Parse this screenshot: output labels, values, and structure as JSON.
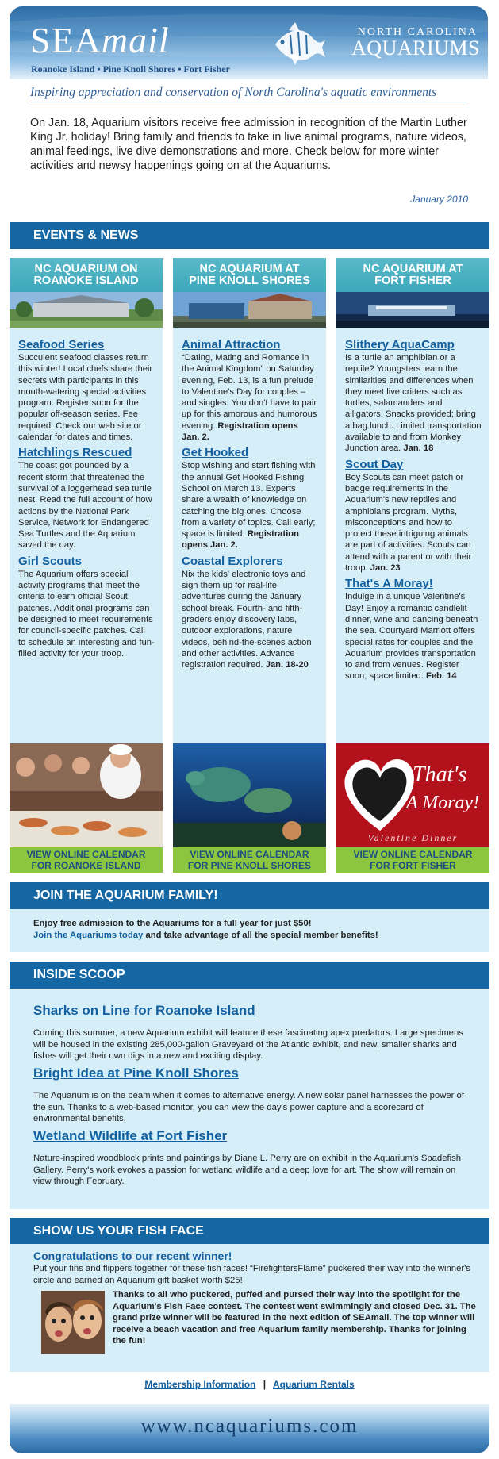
{
  "header": {
    "logo_sea": "SEA",
    "logo_mail": "mail",
    "locations": "Roanoke Island • Pine Knoll Shores • Fort Fisher",
    "org_top": "NORTH CAROLINA",
    "org_main": "AQUARIUMS"
  },
  "tagline": "Inspiring appreciation and conservation of North Carolina's aquatic environments",
  "intro": "On Jan. 18, Aquarium visitors receive free admission in recognition of the Martin Luther King Jr. holiday!  Bring family and friends to take in live animal programs, nature videos, animal feedings, live dive demonstrations and more. Check below for more winter activities and newsy happenings going on at the Aquariums.",
  "date": "January 2010",
  "events": {
    "heading": "EVENTS & NEWS",
    "columns": [
      {
        "title_line1": "NC AQUARIUM ON",
        "title_line2": "ROANOKE ISLAND",
        "items": [
          {
            "title": "Seafood Series",
            "text": "Succulent seafood classes return this winter! Local chefs share their secrets with participants in this mouth-watering special activities program. Register soon for the popular off-season series. Fee required. Check our web site or calendar for dates and times.",
            "bold": ""
          },
          {
            "title": "Hatchlings Rescued",
            "text": "The coast got pounded by a recent storm that threatened the survival of a loggerhead sea turtle nest. Read the full account of how actions by the National Park Service, Network for Endangered Sea Turtles and the Aquarium saved the day.",
            "bold": ""
          },
          {
            "title": "Girl Scouts",
            "text": "The Aquarium offers special activity programs that meet the criteria to earn official Scout patches. Additional programs can be designed to meet requirements for council-specific patches. Call to schedule an interesting and fun-filled activity for your troop.",
            "bold": ""
          }
        ],
        "link_line1": "VIEW ONLINE CALENDAR",
        "link_line2": "FOR ROANOKE ISLAND"
      },
      {
        "title_line1": "NC AQUARIUM AT",
        "title_line2": "PINE KNOLL SHORES",
        "items": [
          {
            "title": "Animal Attraction",
            "text": "“Dating, Mating and Romance in the Animal Kingdom” on Saturday evening, Feb. 13, is a fun prelude to Valentine's Day for couples – and singles. You don't have to pair up for this amorous and humorous evening. ",
            "bold": "Registration opens Jan. 2."
          },
          {
            "title": "Get Hooked",
            "text": "Stop wishing and start fishing with the annual Get Hooked Fishing School on March 13. Experts share a wealth of knowledge on catching the big ones. Choose from a variety of topics. Call early; space is limited. ",
            "bold": "Registration opens Jan. 2."
          },
          {
            "title": "Coastal Explorers",
            "text": "Nix the kids' electronic toys and sign them up for real-life adventures during the January school break. Fourth- and fifth- graders enjoy discovery labs, outdoor explorations, nature videos, behind-the-scenes action and other activities. Advance registration required. ",
            "bold": "Jan. 18-20"
          }
        ],
        "link_line1": "VIEW ONLINE CALENDAR",
        "link_line2": "FOR PINE KNOLL SHORES"
      },
      {
        "title_line1": "NC AQUARIUM AT",
        "title_line2": "FORT FISHER",
        "items": [
          {
            "title": "Slithery AquaCamp",
            "text": "Is a turtle an amphibian or a reptile? Youngsters learn the similarities and differences when they meet live critters such as turtles, salamanders and alligators. Snacks provided; bring a bag lunch. Limited transportation available to and from Monkey Junction area. ",
            "bold": "Jan. 18"
          },
          {
            "title": "Scout Day",
            "text": "Boy Scouts can meet patch or badge requirements in the Aquarium's new reptiles and amphibians program. Myths, misconceptions and how to protect these intriguing animals are part of activities. Scouts can attend with a parent or with their troop. ",
            "bold": "Jan. 23"
          },
          {
            "title": "That's A Moray!",
            "text": "Indulge in a unique Valentine's Day! Enjoy a romantic candlelit dinner, wine and dancing beneath the sea. Courtyard Marriott offers special rates for couples and the Aquarium provides transportation to and from venues. Register soon; space limited. ",
            "bold": "Feb. 14"
          }
        ],
        "link_line1": "VIEW ONLINE CALENDAR",
        "link_line2": "FOR FORT FISHER"
      }
    ],
    "moray_image_line1": "That's",
    "moray_image_line2": "A Moray!",
    "moray_image_sub": "Valentine Dinner"
  },
  "join": {
    "heading": "JOIN THE AQUARIUM FAMILY!",
    "line1": "Enjoy free admission to the Aquariums for a full year for just $50!",
    "link": "Join the Aquariums today",
    "line2_rest": " and take advantage of all the special member benefits!"
  },
  "scoop": {
    "heading": "INSIDE SCOOP",
    "items": [
      {
        "title": "Sharks on Line for Roanoke Island",
        "text": "Coming this summer, a new Aquarium exhibit will feature these fascinating apex predators. Large specimens will be housed in the existing 285,000-gallon Graveyard of the Atlantic exhibit, and new, smaller sharks and fishes will get their own digs in a new and exciting display."
      },
      {
        "title": "Bright Idea at Pine Knoll Shores",
        "text": "The Aquarium is on the beam when it comes to alternative energy. A new solar panel harnesses the power of the sun. Thanks to a web-based monitor, you can view the day's power capture and a scorecard of environmental benefits."
      },
      {
        "title": "Wetland Wildlife at Fort Fisher",
        "text": "Nature-inspired woodblock prints and paintings by Diane L. Perry are on exhibit in the Aquarium's Spadefish Gallery. Perry's work evokes a passion for wetland wildlife and a deep love for art. The show will remain on view through February."
      }
    ]
  },
  "fishface": {
    "heading": "SHOW US YOUR FISH FACE",
    "congrats": "Congratulations to our recent winner!",
    "intro": "Put your fins and flippers together for these fish faces! “FirefightersFlame” puckered their way into the winner's circle and earned an Aquarium gift basket worth $25!",
    "body": "Thanks to all who puckered, puffed and pursed their way into the spotlight for the Aquarium's Fish Face contest. The contest went swimmingly and closed Dec. 31. The grand prize winner will be featured in the next edition of SEAmail. The top winner will receive a beach vacation and free Aquarium family membership. Thanks for joining the fun!"
  },
  "footer": {
    "link1": "Membership Information",
    "separator": "|",
    "link2": "Aquarium Rentals",
    "url": "www.ncaquariums.com"
  },
  "colors": {
    "bar_blue": "#1567a4",
    "panel_light": "#d6eef8",
    "column_head_teal": "#49aec0",
    "link_green": "#8cc63f",
    "link_blue": "#13609f"
  }
}
